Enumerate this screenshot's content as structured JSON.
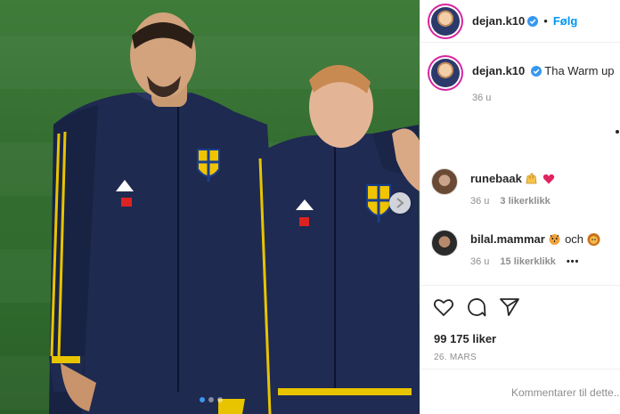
{
  "post": {
    "author": "dejan.k10",
    "follow_label": "Følg",
    "separator": "•",
    "caption_author": "dejan.k10",
    "caption_text": "Tha Warm up",
    "caption_time": "36 u",
    "likes": "99 175 liker",
    "date": "26. MARS",
    "comment_placeholder": "Kommentarer til dette..."
  },
  "comments": [
    {
      "user": "runebaak",
      "time": "36 u",
      "likes": "3 likerklikk",
      "emojis": [
        "raising-hands-emoji",
        "red-heart-emoji"
      ]
    },
    {
      "user": "bilal.mammar",
      "time": "36 u",
      "likes": "15 likerklikk",
      "text_mid": "och",
      "emojis": [
        "tiger-face-emoji",
        "lion-face-emoji"
      ],
      "more": "•••"
    }
  ],
  "colors": {
    "accent": "#0095f6",
    "verified": "#3897f0",
    "heart": "#e0245e",
    "muted": "#8e8e8e"
  },
  "carousel": {
    "slides": 3,
    "active": 1
  }
}
